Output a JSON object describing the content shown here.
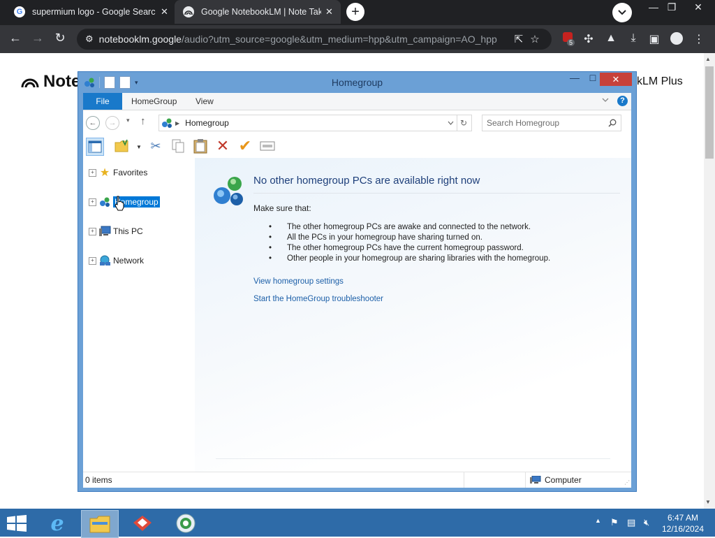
{
  "browser": {
    "tabs": [
      {
        "title": "supermium logo - Google Searc"
      },
      {
        "title": "Google NotebookLM | Note Taki"
      }
    ],
    "address": {
      "domain": "notebooklm.google",
      "path": "/audio?utm_source=google&utm_medium=hpp&utm_campaign=AO_hpp"
    },
    "extension_badge": "5"
  },
  "page": {
    "logo_text": "Note",
    "plus_text": "kLM Plus"
  },
  "explorer": {
    "title": "Homegroup",
    "ribbon_tabs": [
      "File",
      "HomeGroup",
      "View"
    ],
    "address_crumb": "Homegroup",
    "search_placeholder": "Search Homegroup",
    "nav": [
      {
        "label": "Favorites"
      },
      {
        "label": "Homegroup"
      },
      {
        "label": "This PC"
      },
      {
        "label": "Network"
      }
    ],
    "content": {
      "heading": "No other homegroup PCs are available right now",
      "intro": "Make sure that:",
      "bullets": [
        "The other homegroup PCs are awake and connected to the network.",
        "All the PCs in your homegroup have sharing turned on.",
        "The other homegroup PCs have the current homegroup password.",
        "Other people in your homegroup are sharing libraries with the homegroup."
      ],
      "links": [
        "View homegroup settings",
        "Start the HomeGroup troubleshooter"
      ]
    },
    "status": {
      "items": "0 items",
      "location": "Computer"
    }
  },
  "taskbar": {
    "time": "6:47 AM",
    "date": "12/16/2024"
  },
  "colors": {
    "accent": "#1979ca",
    "selection": "#0078d7",
    "link": "#1c5fa8",
    "close": "#c7413a",
    "taskbar": "#2e6ba8"
  }
}
